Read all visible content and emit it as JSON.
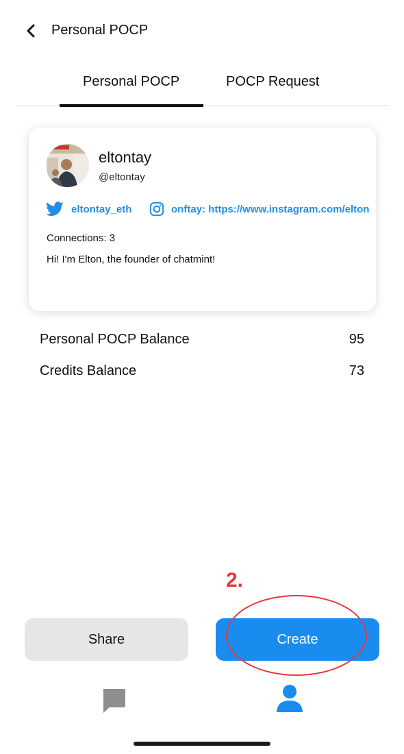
{
  "header": {
    "title": "Personal POCP"
  },
  "tabs": [
    {
      "label": "Personal POCP",
      "active": true
    },
    {
      "label": "POCP Request",
      "active": false
    }
  ],
  "profile": {
    "name": "eltontay",
    "handle": "@eltontay",
    "twitter": "eltontay_eth",
    "instagram": "onftay: https://www.instagram.com/elton",
    "connections": "Connections: 3",
    "bio": "Hi! I'm Elton, the founder of chatmint!"
  },
  "balances": [
    {
      "label": "Personal POCP Balance",
      "value": "95"
    },
    {
      "label": "Credits Balance",
      "value": "73"
    }
  ],
  "annotation": {
    "label": "2.",
    "color": "#e8363c"
  },
  "buttons": {
    "share": "Share",
    "create": "Create"
  },
  "colors": {
    "accent": "#1a8cf0",
    "link": "#1d8fe8",
    "annotation": "#e8363c",
    "nav_inactive": "#8e8e8e"
  },
  "icons": {
    "back": "chevron-left-icon",
    "twitter": "twitter-icon",
    "instagram": "instagram-icon",
    "chat": "chat-bubble-icon",
    "profile": "person-icon"
  }
}
